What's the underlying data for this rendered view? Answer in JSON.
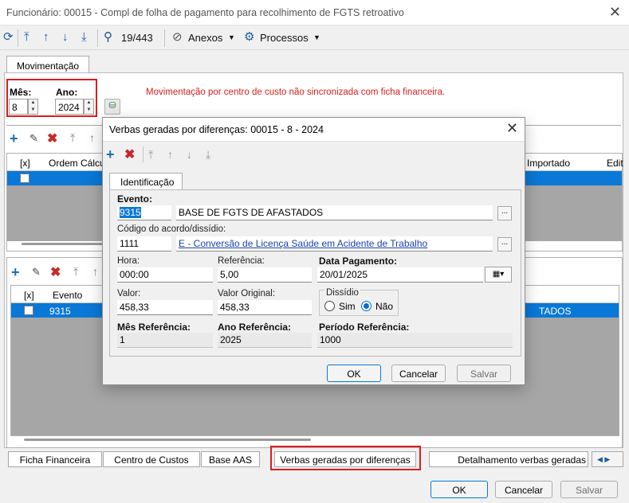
{
  "window": {
    "title": "Funcionário: 00015 - Compl de folha de pagamento para recolhimento de FGTS retroativo"
  },
  "toolbar": {
    "record_pos": "19/443",
    "anexos": "Anexos",
    "processos": "Processos"
  },
  "tabs": {
    "movimentacao": "Movimentação"
  },
  "period": {
    "mes_label": "Mês:",
    "mes_value": "8",
    "ano_label": "Ano:",
    "ano_value": "2024"
  },
  "warning": "Movimentação por centro de custo não sincronizada com ficha financeira.",
  "grid1": {
    "col_check": "[x]",
    "col_ordem": "Ordem Cálculo",
    "col_importado": "Importado",
    "col_edit": "Edit"
  },
  "grid2": {
    "col_check": "[x]",
    "col_evento": "Evento",
    "row_evento": "9315",
    "row_desc": "TADOS"
  },
  "bottom_tabs": [
    "Ficha Financeira",
    "Centro de Custos",
    "Base AAS",
    "Verbas geradas por diferenças",
    "Detalhamento verbas geradas"
  ],
  "main_buttons": {
    "ok": "OK",
    "cancel": "Cancelar",
    "save": "Salvar"
  },
  "dialog": {
    "title": "Verbas geradas por diferenças: 00015 - 8 - 2024",
    "tab": "Identificação",
    "evento_label": "Evento:",
    "evento_code": "9315",
    "evento_desc": "BASE DE FGTS DE AFASTADOS",
    "acordo_label": "Código do acordo/dissídio:",
    "acordo_code": "1111",
    "acordo_desc": "E - Conversão de Licença Saúde em Acidente de Trabalho",
    "hora_label": "Hora:",
    "hora_value": "000:00",
    "referencia_label": "Referência:",
    "referencia_value": "5,00",
    "data_pag_label": "Data Pagamento:",
    "data_pag_value": "20/01/2025",
    "valor_label": "Valor:",
    "valor_value": "458,33",
    "valor_orig_label": "Valor Original:",
    "valor_orig_value": "458,33",
    "dissidio_label": "Dissídio",
    "sim": "Sim",
    "nao": "Não",
    "dissidio_selected": "Não",
    "mes_ref_label": "Mês Referência:",
    "mes_ref_value": "1",
    "ano_ref_label": "Ano Referência:",
    "ano_ref_value": "2025",
    "periodo_ref_label": "Período Referência:",
    "periodo_ref_value": "1000",
    "ok": "OK",
    "cancel": "Cancelar",
    "save": "Salvar"
  },
  "colors": {
    "accent": "#0a78d7",
    "warning": "#d81e1e",
    "highlight_box": "#d81e1e"
  }
}
